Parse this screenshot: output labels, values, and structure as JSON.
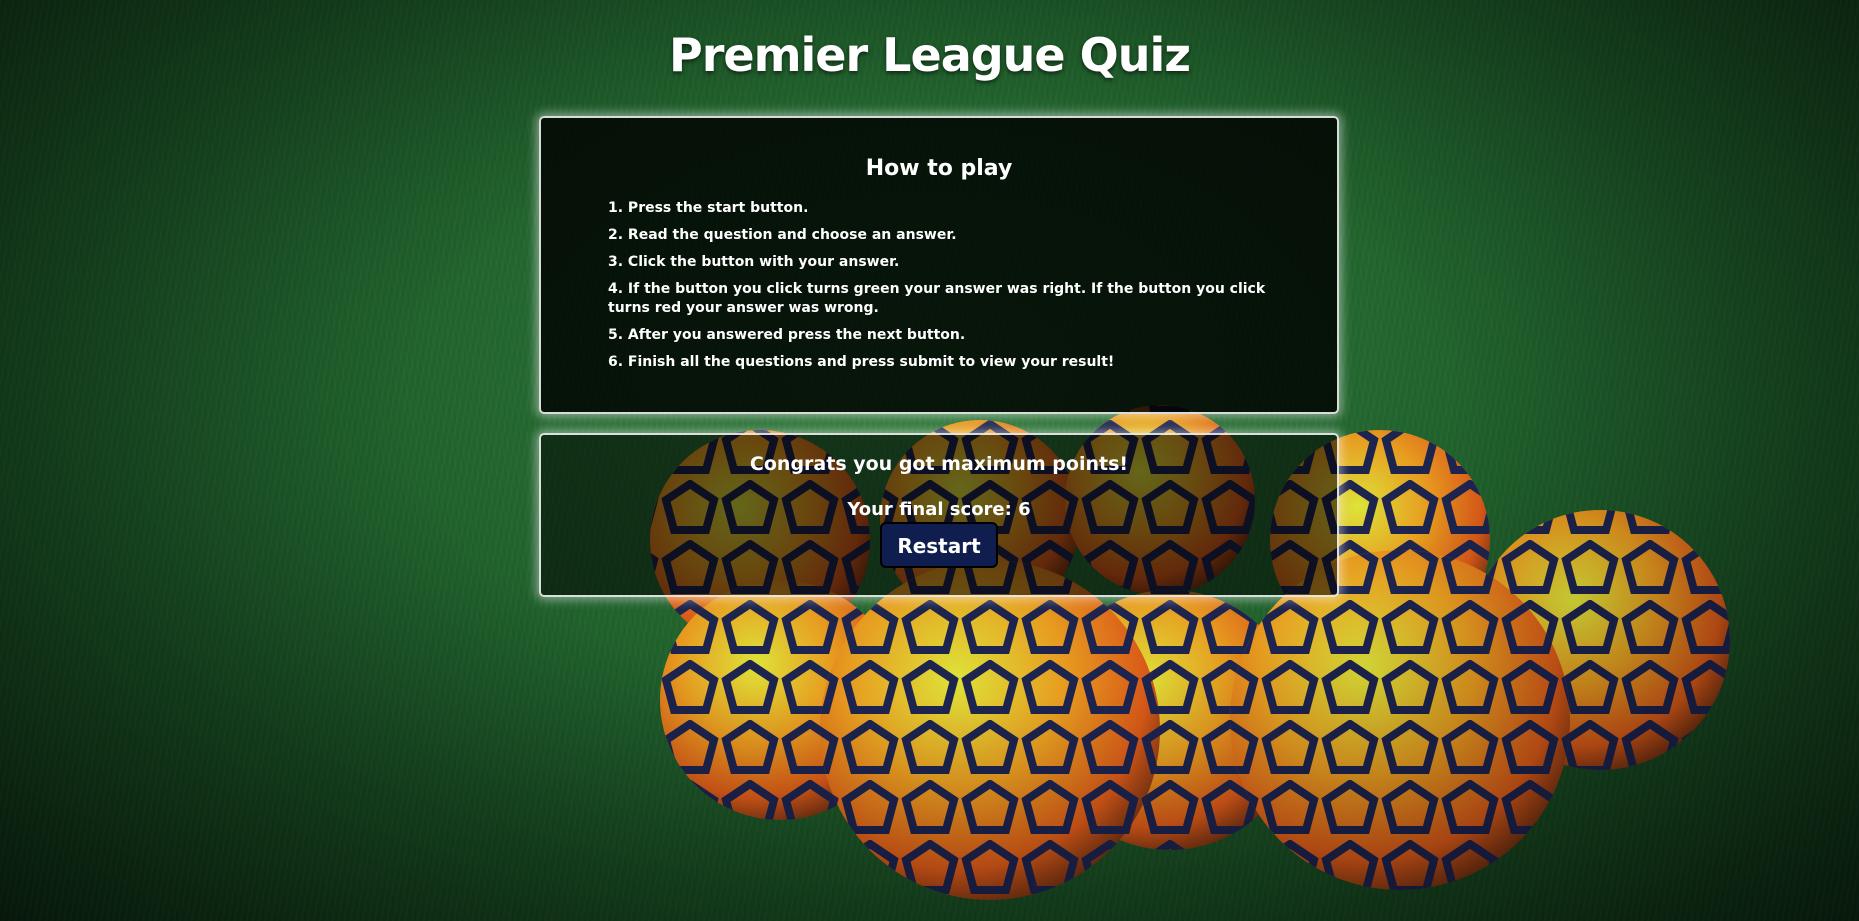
{
  "page": {
    "title": "Premier League Quiz"
  },
  "rules": {
    "heading": "How to play",
    "items": [
      "1. Press the start button.",
      "2. Read the question and choose an answer.",
      "3. Click the button with your answer.",
      "4. If the button you click turns green your answer was right. If the button you click turns red your answer was wrong.",
      "5. After you answered press the next button.",
      "6. Finish all the questions and press submit to view your result!"
    ]
  },
  "result": {
    "message": "Congrats you got maximum points!",
    "score_label": "Your final score: 6",
    "restart_label": "Restart"
  },
  "colors": {
    "button_bg": "#0f1d4f",
    "panel_bg": "#000000",
    "text": "#ffffff"
  }
}
